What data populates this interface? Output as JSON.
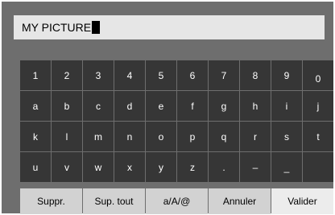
{
  "input": {
    "value": "MY PICTURE"
  },
  "keys": [
    [
      "1",
      "2",
      "3",
      "4",
      "5",
      "6",
      "7",
      "8",
      "9",
      "0"
    ],
    [
      "a",
      "b",
      "c",
      "d",
      "e",
      "f",
      "g",
      "h",
      "i",
      "j"
    ],
    [
      "k",
      "l",
      "m",
      "n",
      "o",
      "p",
      "q",
      "r",
      "s",
      "t"
    ],
    [
      "u",
      "v",
      "w",
      "x",
      "y",
      "z",
      ".",
      "–",
      "_",
      ""
    ]
  ],
  "actions": {
    "delete": "Suppr.",
    "delete_all": "Sup. tout",
    "case_toggle": "a/A/@",
    "cancel": "Annuler",
    "validate": "Valider"
  },
  "colors": {
    "panel": "#6e6e6e",
    "key": "#363636",
    "action": "#d2d2d2",
    "selected_action": "#ececec"
  }
}
